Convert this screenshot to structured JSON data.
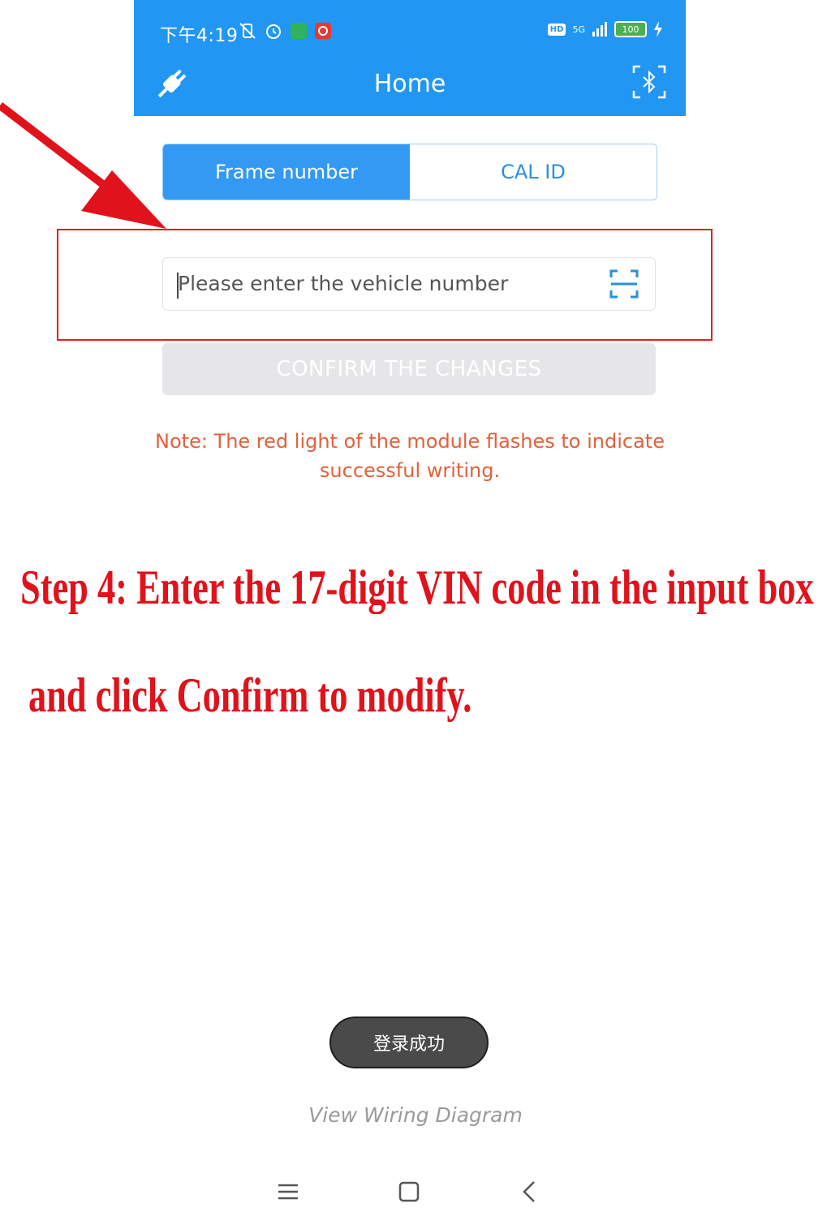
{
  "status_bar": {
    "time": "下午4:19",
    "battery": "100",
    "network": "5G",
    "hd": "HD",
    "icons": [
      "vibrate-off-icon",
      "alarm-icon",
      "boss-app-icon",
      "app-notification-icon",
      "hd-icon",
      "signal-icon",
      "battery-icon",
      "charging-icon"
    ]
  },
  "appbar": {
    "title": "Home",
    "left_icon": "plug-icon",
    "right_icon": "bluetooth-scan-icon"
  },
  "tabs": [
    {
      "label": "Frame number",
      "active": true
    },
    {
      "label": "CAL ID",
      "active": false
    }
  ],
  "input": {
    "placeholder": "Please enter the vehicle number",
    "value": "",
    "icon": "scan-icon"
  },
  "confirm_button": {
    "label": "CONFIRM THE CHANGES",
    "enabled": false
  },
  "note": "Note: The red light of the module flashes to indicate successful writing.",
  "annotation": {
    "line1": "Step 4: Enter the 17-digit VIN code in the input box",
    "line2": "and click Confirm to modify."
  },
  "toast": "登录成功",
  "wiring_link": "View Wiring Diagram",
  "nav": [
    "menu-icon",
    "home-icon",
    "back-icon"
  ],
  "colors": {
    "primary": "#2196F3",
    "note": "#e2613a",
    "annotation": "#e0121b",
    "disabled_button": "#e6e6e9"
  }
}
